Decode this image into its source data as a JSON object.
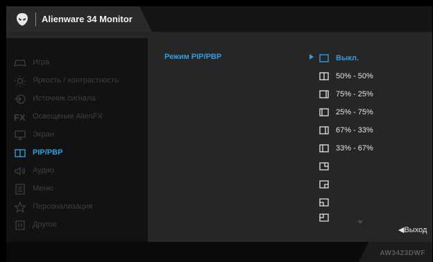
{
  "header": {
    "title": "Alienware 34 Monitor",
    "logo_icon": "alien-head-logo"
  },
  "sidebar": {
    "items": [
      {
        "label": "Игра",
        "icon": "gamepad-icon"
      },
      {
        "label": "Яркость / контрастность",
        "icon": "brightness-icon"
      },
      {
        "label": "Источник сигнала",
        "icon": "input-source-icon"
      },
      {
        "label": "Освещение AlienFX",
        "icon": "alienfx-icon"
      },
      {
        "label": "Экран",
        "icon": "display-icon"
      },
      {
        "label": "PIP/PBP",
        "icon": "pip-pbp-icon"
      },
      {
        "label": "Аудио",
        "icon": "speaker-icon"
      },
      {
        "label": "Меню",
        "icon": "menu-icon"
      },
      {
        "label": "Персонализация",
        "icon": "star-icon"
      },
      {
        "label": "Другое",
        "icon": "other-icon"
      }
    ],
    "active_index": 5
  },
  "main": {
    "section_label": "Режим PIP/PBP",
    "options": [
      {
        "label": "Выкл.",
        "icon": "single-screen-icon",
        "selected": true
      },
      {
        "label": "50%  -  50%",
        "icon": "split-50-50-icon"
      },
      {
        "label": "75% - 25%",
        "icon": "split-75-25-icon"
      },
      {
        "label": "25% - 75%",
        "icon": "split-25-75-icon"
      },
      {
        "label": "67% - 33%",
        "icon": "split-67-33-icon"
      },
      {
        "label": "33% - 67%",
        "icon": "split-33-67-icon"
      },
      {
        "label": "",
        "icon": "pip-top-right-icon"
      },
      {
        "label": "",
        "icon": "pip-bottom-right-icon"
      },
      {
        "label": "",
        "icon": "pip-bottom-left-icon"
      },
      {
        "label": "",
        "icon": "pip-top-left-icon"
      }
    ],
    "exit_label": "◀Выход"
  },
  "footer": {
    "model": "AW3423DWF"
  },
  "colors": {
    "accent": "#2f9fe0",
    "dim_text": "#3f3f3f",
    "bright_text": "#e6e6e6"
  }
}
